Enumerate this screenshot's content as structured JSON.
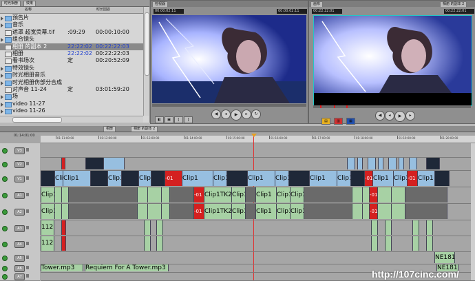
{
  "browser": {
    "tabs": [
      "时光相册",
      "效果"
    ],
    "columns": [
      "名称",
      "时长回容"
    ],
    "rows": [
      {
        "name": "预告片",
        "c2": "",
        "c3": "",
        "icon": "bin",
        "selected": false
      },
      {
        "name": "音乐",
        "c2": "",
        "c3": "",
        "icon": "bin",
        "selected": false
      },
      {
        "name": "遮罩 超宽荧幕.tif",
        "c2": ":09:29",
        "c3": "00:00:10:00",
        "icon": "file",
        "selected": false
      },
      {
        "name": "组合镜头",
        "c2": "",
        "c3": "",
        "icon": "bin",
        "selected": false
      },
      {
        "name": "相册 的副本 2",
        "c2": "22:22:02",
        "c3": "00:22:22:03",
        "icon": "seq",
        "selected": true
      },
      {
        "name": "相册",
        "c2": "22:22:02",
        "c3": "00:22:22:03",
        "icon": "seq",
        "selected": false
      },
      {
        "name": "看书场次",
        "c2": "定",
        "c3": "00:20:52:09",
        "icon": "seq",
        "selected": false
      },
      {
        "name": "特效镜头",
        "c2": "",
        "c3": "",
        "icon": "bin",
        "selected": false
      },
      {
        "name": "时光相册音乐",
        "c2": "",
        "c3": "",
        "icon": "bin",
        "selected": false
      },
      {
        "name": "时光相册伤部分合成",
        "c2": "",
        "c3": "",
        "icon": "bin",
        "selected": false
      },
      {
        "name": "对声音 11-24",
        "c2": "定",
        "c3": "03:01:59:20",
        "icon": "seq",
        "selected": false
      },
      {
        "name": "场",
        "c2": "",
        "c3": "",
        "icon": "bin",
        "selected": false
      },
      {
        "name": "video 11-27",
        "c2": "",
        "c3": "",
        "icon": "bin",
        "selected": false
      },
      {
        "name": "video 11-26",
        "c2": "",
        "c3": "",
        "icon": "bin",
        "selected": false
      }
    ]
  },
  "viewer": {
    "tab": "检视器",
    "timecode_left": "00:00:02:11",
    "timecode_right": "00:00:02:11"
  },
  "canvas": {
    "tab": "画布",
    "timecode_left": "00:22:22:01",
    "timecode_right": "00:22:22:01",
    "sequence_tab": "相册 的副本 2"
  },
  "timeline": {
    "tabs": [
      "相册",
      "相册 的副本 2"
    ],
    "timecode": "01:14:01:00",
    "ruler_labels": [
      "01:11:00:00",
      "01:12:00:00",
      "01:13:00:00",
      "01:14:00:00",
      "01:15:00:00",
      "01:16:00:00",
      "01:17:00:00",
      "01:18:00:00",
      "01:19:00:00",
      "01:20:00:00"
    ],
    "tracks": [
      "V3",
      "V2",
      "V1",
      "A1",
      "A2",
      "A3",
      "A4",
      "A5",
      "A6",
      "A7"
    ],
    "clip_label": "Clip1",
    "clip_label_long": "Clip1TK2S0",
    "red_label": "-01",
    "audio_num": "112",
    "mp3_a": "Tower.mp3",
    "mp3_b": "Requiem For A Tower.mp3",
    "small_clip": "NE181"
  },
  "watermark": "http://107cinc.com/"
}
